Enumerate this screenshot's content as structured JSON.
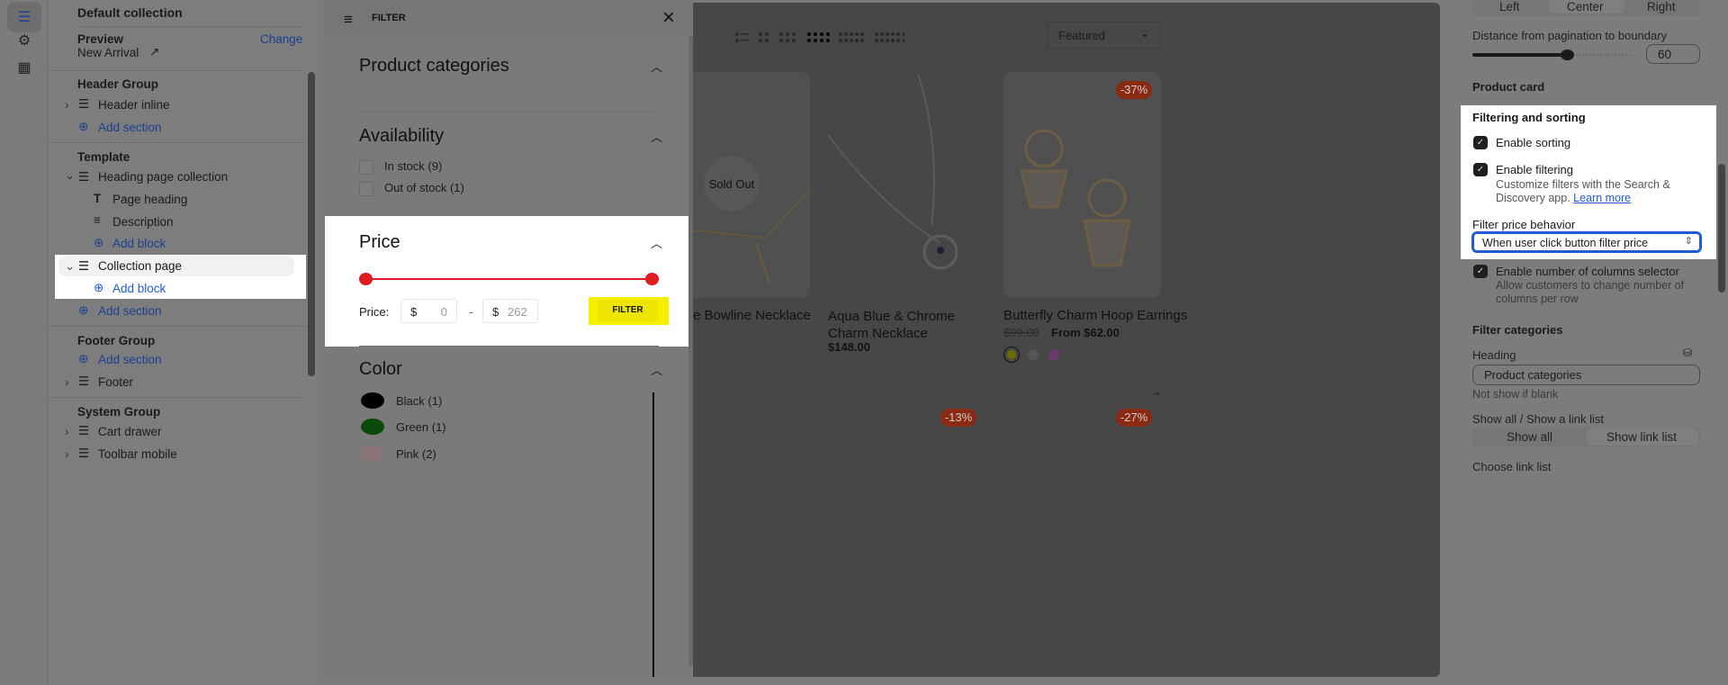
{
  "rail": {
    "icons": [
      "sections-icon",
      "settings-gear-icon",
      "apps-icon"
    ]
  },
  "sidebar": {
    "title": "Default collection",
    "preview_label": "Preview",
    "preview_change": "Change",
    "preview_value": "New Arrival",
    "header_group": {
      "title": "Header Group",
      "items": [
        "Header inline"
      ],
      "add": "Add section"
    },
    "template": {
      "title": "Template",
      "heading_section": "Heading page collection",
      "blocks": [
        "Page heading",
        "Description"
      ],
      "add_block": "Add block",
      "collection_section": "Collection page",
      "add_block2": "Add block",
      "add_section": "Add section"
    },
    "footer_group": {
      "title": "Footer Group",
      "add": "Add section",
      "items": [
        "Footer"
      ]
    },
    "system_group": {
      "title": "System Group",
      "items": [
        "Cart drawer",
        "Toolbar mobile"
      ]
    }
  },
  "drawer": {
    "title": "FILTER",
    "sections": {
      "categories": "Product categories",
      "availability": "Availability",
      "price": "Price",
      "color": "Color"
    },
    "availability": [
      "In stock (9)",
      "Out of stock (1)"
    ],
    "price": {
      "label": "Price:",
      "currency": "$",
      "min": "0",
      "max": "262",
      "separator": "-",
      "button": "FILTER",
      "range_fraction": [
        0,
        1
      ],
      "accent": "#e11b22",
      "highlight": "#f5e600"
    },
    "colors": [
      {
        "label": "Black (1)",
        "hex": "#000000"
      },
      {
        "label": "Green (1)",
        "hex": "#0a5c0a"
      },
      {
        "label": "Pink (2)",
        "hex": "#c9a0a6"
      }
    ]
  },
  "main": {
    "sort": "Featured",
    "layouts": [
      "list",
      "2-col",
      "3-col",
      "4-col",
      "5-col",
      "6-col"
    ],
    "active_layout": "4-col",
    "products": [
      {
        "title": "e Bowline Necklace",
        "sold_out": "Sold Out"
      },
      {
        "title": "Aqua Blue & Chrome Charm Necklace",
        "price": "$148.00"
      },
      {
        "title": "Butterfly Charm Hoop Earrings",
        "old_price": "$99.00",
        "price": "From $62.00",
        "badge": "-37%",
        "swatches": [
          "#6b6b00",
          "#6a6a6a",
          "#7a3a7a"
        ]
      }
    ],
    "row2_badges": [
      "-13%",
      "-27%"
    ]
  },
  "settings": {
    "alignment": [
      "Left",
      "Center",
      "Right"
    ],
    "alignment_selected": "Center",
    "distance_label": "Distance from pagination to boundary",
    "distance_value": "60",
    "distance_fraction": 0.6,
    "product_card": "Product card",
    "filtering_title": "Filtering and sorting",
    "enable_sorting": "Enable sorting",
    "enable_filtering": "Enable filtering",
    "filtering_help": "Customize filters with the Search & Discovery app.",
    "learn_more": "Learn more",
    "price_behavior_label": "Filter price behavior",
    "price_behavior_value": "When user click button filter price",
    "columns_selector": "Enable number of columns selector",
    "columns_help": "Allow customers to change number of columns per row",
    "filter_categories": "Filter categories",
    "heading_label": "Heading",
    "heading_value": "Product categories",
    "heading_help": "Not show if blank",
    "show_label": "Show all / Show a link list",
    "show_options": [
      "Show all",
      "Show link list"
    ],
    "show_selected": "Show link list",
    "choose_link_list": "Choose link list"
  }
}
